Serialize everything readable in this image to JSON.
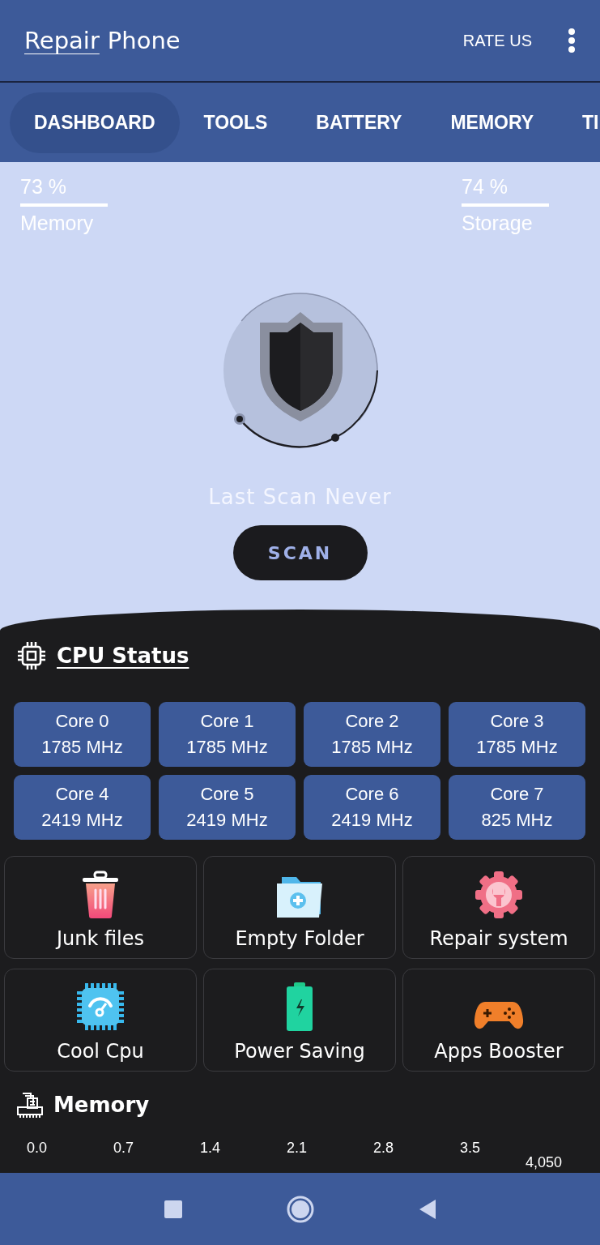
{
  "app_bar": {
    "title_link": "Repair",
    "title_rest": "Phone",
    "rate_button": "RATE US"
  },
  "tabs": [
    {
      "label": "DASHBOARD",
      "selected": true
    },
    {
      "label": "TOOLS",
      "selected": false
    },
    {
      "label": "BATTERY",
      "selected": false
    },
    {
      "label": "MEMORY",
      "selected": false
    },
    {
      "label": "TI",
      "selected": false
    }
  ],
  "stats": [
    {
      "value": "73 %",
      "label": "Memory"
    },
    {
      "value": "74 %",
      "label": "Storage"
    }
  ],
  "scan": {
    "status": "Last Scan Never",
    "button": "SCAN"
  },
  "cpu_status": {
    "title": "CPU Status",
    "cores": [
      {
        "name": "Core 0",
        "freq": "1785 MHz"
      },
      {
        "name": "Core 1",
        "freq": "1785 MHz"
      },
      {
        "name": "Core 2",
        "freq": "1785 MHz"
      },
      {
        "name": "Core 3",
        "freq": "1785 MHz"
      },
      {
        "name": "Core 4",
        "freq": "2419 MHz"
      },
      {
        "name": "Core 5",
        "freq": "2419 MHz"
      },
      {
        "name": "Core 6",
        "freq": "2419 MHz"
      },
      {
        "name": "Core 7",
        "freq": "825 MHz"
      }
    ]
  },
  "tools": [
    {
      "kind": "trash",
      "label": "Junk files"
    },
    {
      "kind": "folder",
      "label": "Empty Folder"
    },
    {
      "kind": "gear",
      "label": "Repair system"
    },
    {
      "kind": "chip",
      "label": "Cool Cpu"
    },
    {
      "kind": "battery",
      "label": "Power Saving"
    },
    {
      "kind": "gamepad",
      "label": "Apps Booster"
    }
  ],
  "memory": {
    "title": "Memory",
    "axis_ticks": [
      "0.0",
      "0.7",
      "1.4",
      "2.1",
      "2.8",
      "3.5"
    ],
    "end_label": "4,050"
  }
}
